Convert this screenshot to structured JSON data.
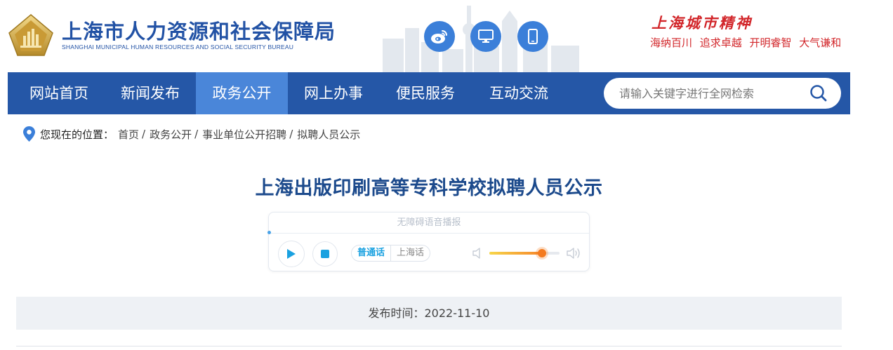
{
  "header": {
    "title": "上海市人力资源和社会保障局",
    "subtitle": "SHANGHAI MUNICIPAL HUMAN RESOURCES AND SOCIAL SECURITY BUREAU",
    "spirit_title": "上海城市精神",
    "spirit_motto": "海纳百川 追求卓越 开明睿智 大气谦和",
    "social_icons": [
      "weibo-icon",
      "desktop-icon",
      "mobile-icon"
    ]
  },
  "nav": {
    "items": [
      {
        "label": "网站首页"
      },
      {
        "label": "新闻发布"
      },
      {
        "label": "政务公开",
        "active": true
      },
      {
        "label": "网上办事"
      },
      {
        "label": "便民服务"
      },
      {
        "label": "互动交流"
      }
    ],
    "search_placeholder": "请输入关键字进行全网检索"
  },
  "breadcrumb": {
    "label": "您现在的位置：",
    "items": [
      "首页",
      "政务公开",
      "事业单位公开招聘",
      "拟聘人员公示"
    ],
    "separator": "/"
  },
  "article": {
    "title": "上海出版印刷高等专科学校拟聘人员公示",
    "publish_time": "发布时间：2022-11-10"
  },
  "player": {
    "header": "无障碍语音播报",
    "dialects": [
      "普通话",
      "上海话"
    ],
    "selected_dialect": "普通话",
    "volume_percent": 75
  },
  "colors": {
    "brand_blue": "#2557a7",
    "nav_active": "#4a86d9",
    "title_blue": "#1c4a8c",
    "spirit_red": "#d2262a",
    "accent_cyan": "#1aa1e0",
    "volume_orange": "#f47b20"
  }
}
